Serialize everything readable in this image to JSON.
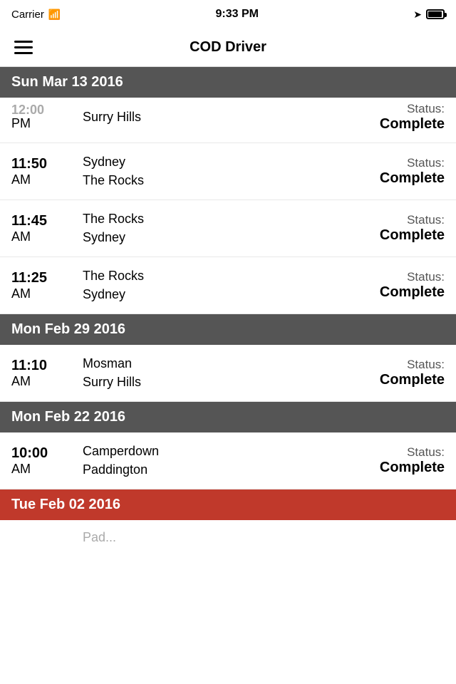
{
  "statusBar": {
    "carrier": "Carrier",
    "time": "9:33 PM"
  },
  "header": {
    "title": "COD Driver",
    "menuLabel": "Menu"
  },
  "sections": [
    {
      "id": "sun-mar-13",
      "dateLabel": "Sun Mar 13 2016",
      "color": "dark",
      "partialRow": {
        "timeTop": "12:00",
        "timeAmPm": "PM",
        "from": "",
        "to": "Surry Hills",
        "statusLabel": "Status:",
        "statusValue": "Complete"
      },
      "trips": [
        {
          "timeMain": "11:50",
          "timeAmPm": "AM",
          "from": "Sydney",
          "to": "The Rocks",
          "statusLabel": "Status:",
          "statusValue": "Complete"
        },
        {
          "timeMain": "11:45",
          "timeAmPm": "AM",
          "from": "The Rocks",
          "to": "Sydney",
          "statusLabel": "Status:",
          "statusValue": "Complete"
        },
        {
          "timeMain": "11:25",
          "timeAmPm": "AM",
          "from": "The Rocks",
          "to": "Sydney",
          "statusLabel": "Status:",
          "statusValue": "Complete"
        }
      ]
    },
    {
      "id": "mon-feb-29",
      "dateLabel": "Mon Feb 29 2016",
      "color": "dark",
      "trips": [
        {
          "timeMain": "11:10",
          "timeAmPm": "AM",
          "from": "Mosman",
          "to": "Surry Hills",
          "statusLabel": "Status:",
          "statusValue": "Complete"
        }
      ]
    },
    {
      "id": "mon-feb-22",
      "dateLabel": "Mon Feb 22 2016",
      "color": "dark",
      "trips": [
        {
          "timeMain": "10:00",
          "timeAmPm": "AM",
          "from": "Camperdown",
          "to": "Paddington",
          "statusLabel": "Status:",
          "statusValue": "Complete"
        }
      ]
    },
    {
      "id": "tue-feb-02",
      "dateLabel": "Tue Feb 02 2016",
      "color": "red",
      "trips": []
    }
  ],
  "bottomPartial": {
    "text": "Pad..."
  }
}
